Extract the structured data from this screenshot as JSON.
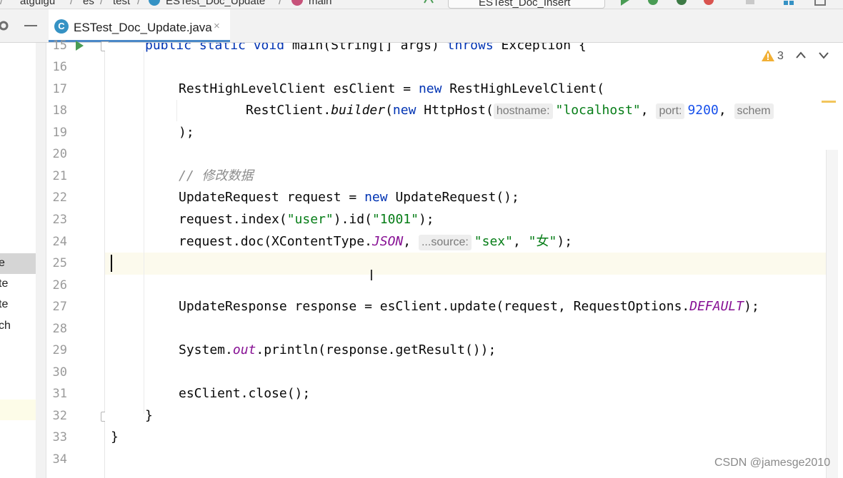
{
  "breadcrumbs": [
    "atguigu",
    "es",
    "test",
    "ESTest_Doc_Update",
    "main"
  ],
  "run_config": "ESTest_Doc_Insert",
  "tab": {
    "label": "ESTest_Doc_Update.java",
    "close": "×"
  },
  "tree_items": [
    "e",
    "te",
    "te",
    "ch"
  ],
  "warnings": {
    "count": "3"
  },
  "line_numbers": [
    "15",
    "16",
    "17",
    "18",
    "19",
    "20",
    "21",
    "22",
    "23",
    "24",
    "25",
    "26",
    "27",
    "28",
    "29",
    "30",
    "31",
    "32",
    "33",
    "34"
  ],
  "code": {
    "l15_a": "public static void ",
    "l15_b": "main",
    "l15_c": "(String[] args) ",
    "l15_d": "throws",
    "l15_e": " Exception {",
    "l17_a": "RestHighLevelClient esClient = ",
    "l17_b": "new",
    "l17_c": " RestHighLevelClient(",
    "l18_a": "RestClient.",
    "l18_b": "builder",
    "l18_c": "(",
    "l18_d": "new",
    "l18_e": " HttpHost(",
    "l18_hint1": "hostname:",
    "l18_str": "\"localhost\"",
    "l18_f": ", ",
    "l18_hint2": "port:",
    "l18_num": "9200",
    "l18_g": ", ",
    "l18_hint3": "schem",
    "l19": ");",
    "l21": "// 修改数据",
    "l22_a": "UpdateRequest request = ",
    "l22_b": "new",
    "l22_c": " UpdateRequest();",
    "l23_a": "request.index(",
    "l23_b": "\"user\"",
    "l23_c": ").id(",
    "l23_d": "\"1001\"",
    "l23_e": ");",
    "l24_a": "request.doc(XContentType.",
    "l24_b": "JSON",
    "l24_c": ", ",
    "l24_hint": "...source:",
    "l24_d": "\"sex\"",
    "l24_e": ", ",
    "l24_f": "\"女\"",
    "l24_g": ");",
    "l27_a": "UpdateResponse response = esClient.update(request, RequestOptions.",
    "l27_b": "DEFAULT",
    "l27_c": ");",
    "l29_a": "System.",
    "l29_b": "out",
    "l29_c": ".println(response.getResult());",
    "l31": "esClient.close();",
    "l32": "}",
    "l33": "}"
  },
  "watermark": "CSDN @jamesge2010",
  "colors": {
    "keyword": "#0033b3",
    "string": "#067d17",
    "number": "#1750eb",
    "comment": "#8c8c8c",
    "static_field": "#871094",
    "current_line": "#fcfaed"
  }
}
